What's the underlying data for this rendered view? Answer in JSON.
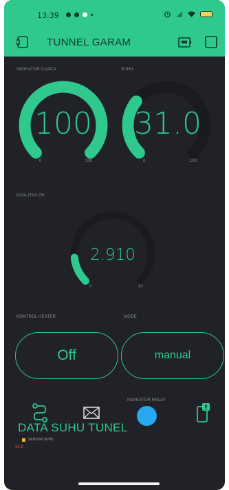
{
  "status_bar": {
    "time": "13:39"
  },
  "app": {
    "title": "TUNNEL GARAM"
  },
  "gauges": [
    {
      "label": "INDIKATOR CUACA",
      "value_text": "100",
      "value": 100,
      "min": 0,
      "max": 100,
      "min_label": "0",
      "max_label": "100",
      "fraction": 1.0
    },
    {
      "label": "SUHU",
      "value_text": "31.0",
      "value": 31.0,
      "min": 0,
      "max": 100,
      "min_label": "0",
      "max_label": "100",
      "fraction": 0.31
    },
    {
      "label": "KUALITAS PH",
      "value_text": "2.910",
      "value": 2.91,
      "min": 0,
      "max": 20,
      "min_label": "0",
      "max_label": "20",
      "fraction": 0.1455
    }
  ],
  "controls": {
    "heater_label": "KONTROL HEATER",
    "heater_state": "Off",
    "mode_label": "MODE",
    "mode_state": "manual"
  },
  "relay": {
    "label": "INDIKATOR RELAY",
    "color": "#27a9f2"
  },
  "chart": {
    "title": "DATA SUHU TUNEL",
    "legend": "SENSOR SUHU",
    "latest_value": "33.9"
  },
  "colors": {
    "accent": "#2fc98e",
    "background": "#212227",
    "track": "#1a1b1e"
  },
  "icons": [
    "device-icon",
    "battery-icon",
    "square-icon",
    "route-icon",
    "mail-icon",
    "phone-notification-icon"
  ]
}
